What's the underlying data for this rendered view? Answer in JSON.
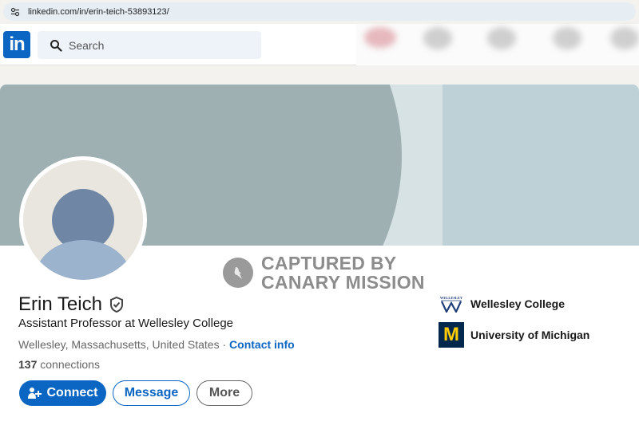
{
  "browser": {
    "url": "linkedin.com/in/erin-teich-53893123/"
  },
  "nav": {
    "logo": "in",
    "search_placeholder": "Search"
  },
  "watermark": {
    "line1": "CAPTURED BY",
    "line2": "CANARY MISSION"
  },
  "profile": {
    "name": "Erin Teich",
    "headline": "Assistant Professor at Wellesley College",
    "location": "Wellesley, Massachusetts, United States",
    "separator": " · ",
    "contact_info": "Contact info",
    "connections_count": "137",
    "connections_label": " connections"
  },
  "actions": {
    "connect": "Connect",
    "message": "Message",
    "more": "More"
  },
  "education": [
    {
      "name": "Wellesley College",
      "logo_text": "WELLESLEY"
    },
    {
      "name": "University of Michigan",
      "logo_text": "M"
    }
  ],
  "colors": {
    "brand": "#0a66c2",
    "michigan_blue": "#00274c",
    "michigan_maize": "#ffcb05"
  }
}
